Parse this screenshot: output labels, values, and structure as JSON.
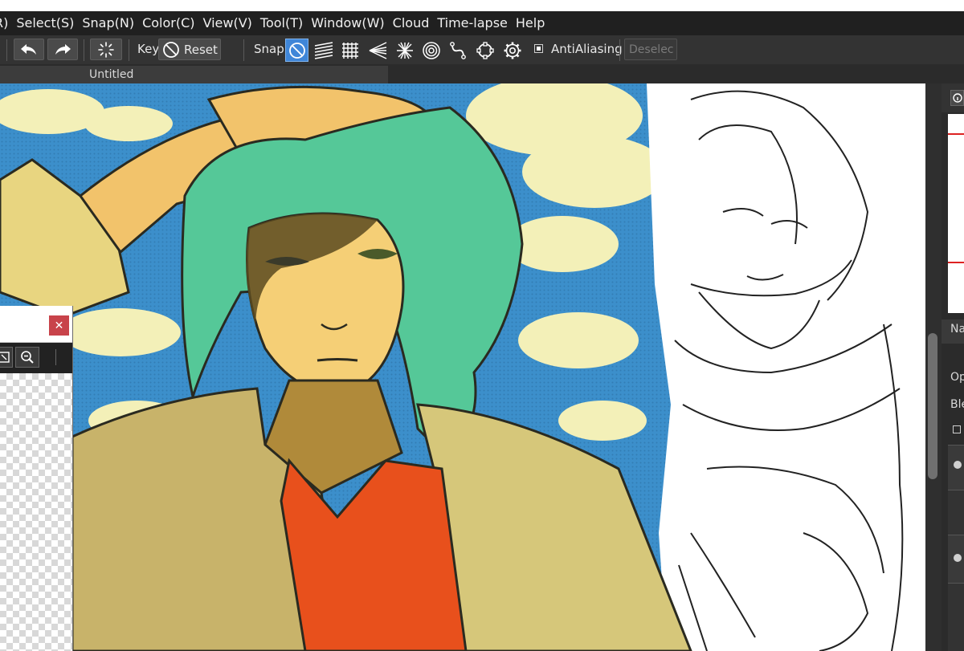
{
  "menubar": {
    "items": [
      "R)",
      "Select(S)",
      "Snap(N)",
      "Color(C)",
      "View(V)",
      "Tool(T)",
      "Window(W)",
      "Cloud",
      "Time-lapse",
      "Help"
    ]
  },
  "toolbar": {
    "key_label": "Key",
    "reset_label": "Reset",
    "snap_label": "Snap",
    "antialiasing_label": "AntiAliasing",
    "deselect_label": "Deselec"
  },
  "document": {
    "tab_title": "Untitled"
  },
  "right_panel": {
    "labels": [
      "Na",
      "Op",
      "Ble"
    ]
  },
  "colors": {
    "menubar_bg": "#202020",
    "toolbar_bg": "#333333",
    "snap_active": "#3f86d8",
    "close_button": "#c8434a"
  },
  "icons": [
    "undo-icon",
    "redo-icon",
    "transform-icon",
    "no-snap-icon",
    "parallel-lines-icon",
    "grid-icon",
    "vanishing-point-icon",
    "radial-lines-icon",
    "concentric-circles-icon",
    "curve-icon",
    "ellipse-icon",
    "settings-gear-icon",
    "fit-window-icon",
    "zoom-out-icon",
    "close-icon"
  ]
}
